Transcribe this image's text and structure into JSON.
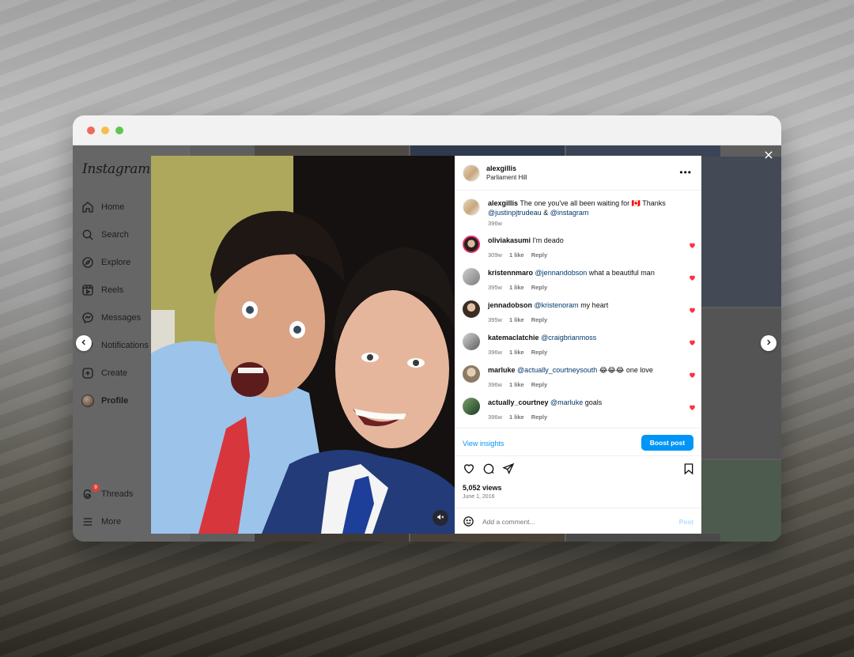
{
  "app": "Instagram",
  "sidebar": {
    "logo": "Instagram",
    "items": [
      {
        "label": "Home",
        "icon": "home-icon"
      },
      {
        "label": "Search",
        "icon": "search-icon"
      },
      {
        "label": "Explore",
        "icon": "compass-icon"
      },
      {
        "label": "Reels",
        "icon": "reels-icon"
      },
      {
        "label": "Messages",
        "icon": "messenger-icon"
      },
      {
        "label": "Notifications",
        "icon": "heart-icon"
      },
      {
        "label": "Create",
        "icon": "plus-square-icon"
      },
      {
        "label": "Profile",
        "icon": "avatar"
      }
    ],
    "bottom": [
      {
        "label": "Threads",
        "icon": "threads-icon",
        "badge": "9"
      },
      {
        "label": "More",
        "icon": "hamburger-icon"
      }
    ]
  },
  "post": {
    "author": "alexgillis",
    "location": "Parliament Hill",
    "caption": {
      "user": "alexgillis",
      "text": "The one you've all been waiting for",
      "flag": "🇨🇦",
      "text2": "Thanks",
      "mention1": "@justinpjtrudeau",
      "amp": "&",
      "mention2": "@instagram",
      "time": "396w"
    },
    "comments": [
      {
        "user": "oliviakasumi",
        "mention": "",
        "text": "I'm deado",
        "time": "309w",
        "likes": "1 like",
        "reply": "Reply"
      },
      {
        "user": "kristennmaro",
        "mention": "@jennandobson",
        "text": "what a beautiful man",
        "time": "395w",
        "likes": "1 like",
        "reply": "Reply"
      },
      {
        "user": "jennadobson",
        "mention": "@kristenoram",
        "text": "my heart",
        "time": "395w",
        "likes": "1 like",
        "reply": "Reply"
      },
      {
        "user": "katemaclatchie",
        "mention": "@craigbrianmoss",
        "text": "",
        "time": "396w",
        "likes": "1 like",
        "reply": "Reply"
      },
      {
        "user": "marluke",
        "mention": "@actually_courtneysouth",
        "text": "😂😂😂 one love",
        "time": "396w",
        "likes": "1 like",
        "reply": "Reply"
      },
      {
        "user": "actually_courtney",
        "mention": "@marluke",
        "text": "goals",
        "time": "396w",
        "likes": "1 like",
        "reply": "Reply"
      }
    ],
    "view_insights": "View insights",
    "boost": "Boost post",
    "views": "5,052 views",
    "date": "June 1, 2016",
    "add_comment_placeholder": "Add a comment...",
    "post_label": "Post"
  },
  "colors": {
    "accent": "#0095f6",
    "like": "#ff3040"
  }
}
